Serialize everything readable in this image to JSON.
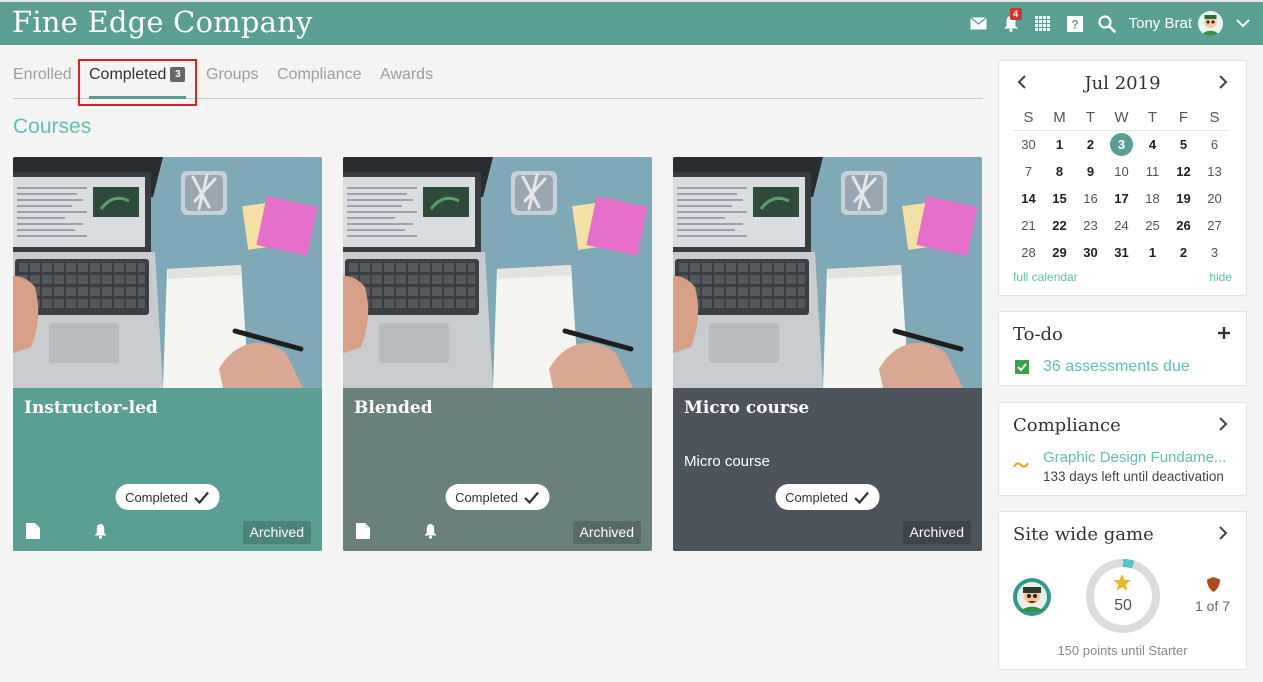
{
  "header": {
    "brand": "Fine Edge Company",
    "notification_count": "4",
    "user_name": "Tony Brat",
    "colors": {
      "header_bg": "#5b9f94",
      "badge": "#d9302c"
    },
    "icons": [
      "mail-icon",
      "bell-icon",
      "calendar-icon",
      "help-icon",
      "search-icon",
      "chevron-down-icon"
    ]
  },
  "tabs": {
    "items": [
      {
        "label": "Enrolled"
      },
      {
        "label": "Completed",
        "count": "3",
        "active": true
      },
      {
        "label": "Groups"
      },
      {
        "label": "Compliance"
      },
      {
        "label": "Awards"
      }
    ]
  },
  "section_title": "Courses",
  "cards": [
    {
      "title": "Instructor-led",
      "subtitle": "",
      "status": "Completed",
      "archived": "Archived",
      "color": "#5b9f94"
    },
    {
      "title": "Blended",
      "subtitle": "",
      "status": "Completed",
      "archived": "Archived",
      "color": "#6a807d"
    },
    {
      "title": "Micro course",
      "subtitle": "Micro course",
      "status": "Completed",
      "archived": "Archived",
      "color": "#4d545b"
    }
  ],
  "calendar": {
    "month": "Jul 2019",
    "dow": [
      "S",
      "M",
      "T",
      "W",
      "T",
      "F",
      "S"
    ],
    "weeks": [
      [
        "30",
        "1",
        "2",
        "3",
        "4",
        "5",
        "6"
      ],
      [
        "7",
        "8",
        "9",
        "10",
        "11",
        "12",
        "13"
      ],
      [
        "14",
        "15",
        "16",
        "17",
        "18",
        "19",
        "20"
      ],
      [
        "21",
        "22",
        "23",
        "24",
        "25",
        "26",
        "27"
      ],
      [
        "28",
        "29",
        "30",
        "31",
        "1",
        "2",
        "3"
      ]
    ],
    "bold": [
      [
        false,
        true,
        true,
        false,
        true,
        true,
        false
      ],
      [
        false,
        true,
        true,
        false,
        false,
        true,
        false
      ],
      [
        true,
        true,
        false,
        true,
        false,
        true,
        false
      ],
      [
        false,
        true,
        false,
        false,
        false,
        true,
        false
      ],
      [
        false,
        true,
        true,
        true,
        true,
        true,
        false
      ]
    ],
    "today": "3",
    "full_calendar_link": "full calendar",
    "hide_link": "hide"
  },
  "todo": {
    "title": "To-do",
    "item": "36 assessments due"
  },
  "compliance": {
    "title": "Compliance",
    "course": "Graphic Design Fundame...",
    "note": "133 days left until deactivation"
  },
  "game": {
    "title": "Site wide game",
    "points": "50",
    "points_progress_fraction": 0.05,
    "rank": "1 of 7",
    "footer": "150 points until Starter"
  }
}
